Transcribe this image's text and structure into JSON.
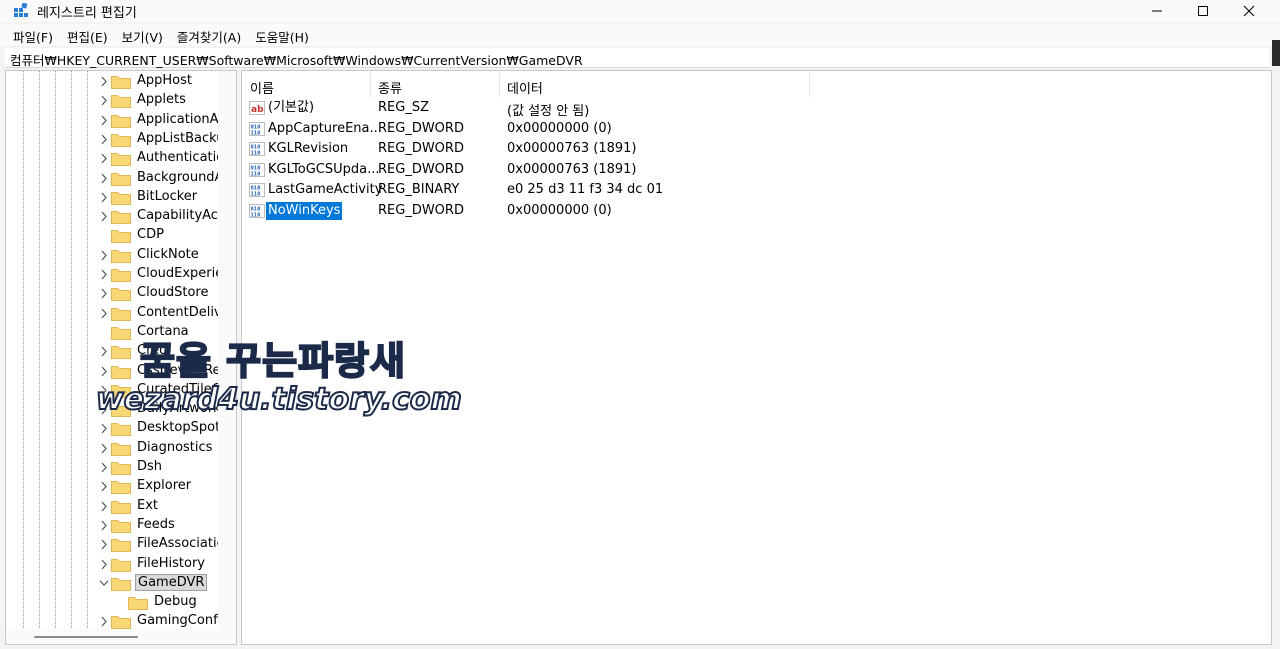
{
  "window": {
    "title": "레지스트리 편집기"
  },
  "menu": [
    "파일(F)",
    "편집(E)",
    "보기(V)",
    "즐겨찾기(A)",
    "도움말(H)"
  ],
  "address": "컴퓨터₩HKEY_CURRENT_USER₩Software₩Microsoft₩Windows₩CurrentVersion₩GameDVR",
  "tree": {
    "items": [
      {
        "label": "AppHost"
      },
      {
        "label": "Applets"
      },
      {
        "label": "ApplicationAss"
      },
      {
        "label": "AppListBackup"
      },
      {
        "label": "Authentication"
      },
      {
        "label": "BackgroundAc"
      },
      {
        "label": "BitLocker"
      },
      {
        "label": "CapabilityAcce"
      },
      {
        "label": "CDP"
      },
      {
        "label": "ClickNote"
      },
      {
        "label": "CloudExperien"
      },
      {
        "label": "CloudStore"
      },
      {
        "label": "ContentDelive"
      },
      {
        "label": "Cortana"
      },
      {
        "label": "Cred"
      },
      {
        "label": "CssDeviceRe"
      },
      {
        "label": "CuratedTileCo"
      },
      {
        "label": "DailyArtwork"
      },
      {
        "label": "DesktopSpotli"
      },
      {
        "label": "Diagnostics"
      },
      {
        "label": "Dsh"
      },
      {
        "label": "Explorer"
      },
      {
        "label": "Ext"
      },
      {
        "label": "Feeds"
      },
      {
        "label": "FileAssociation"
      },
      {
        "label": "FileHistory"
      },
      {
        "label": "GameDVR"
      },
      {
        "label": "Debug"
      },
      {
        "label": "GamingConfic"
      }
    ]
  },
  "list": {
    "headers": {
      "name": "이름",
      "type": "종류",
      "data": "데이터"
    },
    "rows": [
      {
        "icon": "string-value-icon",
        "name": "(기본값)",
        "type": "REG_SZ",
        "data": "(값 설정 안 됨)"
      },
      {
        "icon": "binary-value-icon",
        "name": "AppCaptureEna...",
        "type": "REG_DWORD",
        "data": "0x00000000 (0)"
      },
      {
        "icon": "binary-value-icon",
        "name": "KGLRevision",
        "type": "REG_DWORD",
        "data": "0x00000763 (1891)"
      },
      {
        "icon": "binary-value-icon",
        "name": "KGLToGCSUpda...",
        "type": "REG_DWORD",
        "data": "0x00000763 (1891)"
      },
      {
        "icon": "binary-value-icon",
        "name": "LastGameActivity",
        "type": "REG_BINARY",
        "data": "e0 25 d3 11 f3 34 dc 01"
      },
      {
        "icon": "binary-value-icon",
        "name": "NoWinKeys",
        "type": "REG_DWORD",
        "data": "0x00000000 (0)"
      }
    ]
  },
  "watermark": {
    "line1": "꿈을 꾸는파랑새",
    "line2": "wezard4u.tistory.com"
  },
  "colors": {
    "selection": "#0078d7",
    "folder": "#f8d775",
    "tree_selected": "#d9d9d9"
  }
}
